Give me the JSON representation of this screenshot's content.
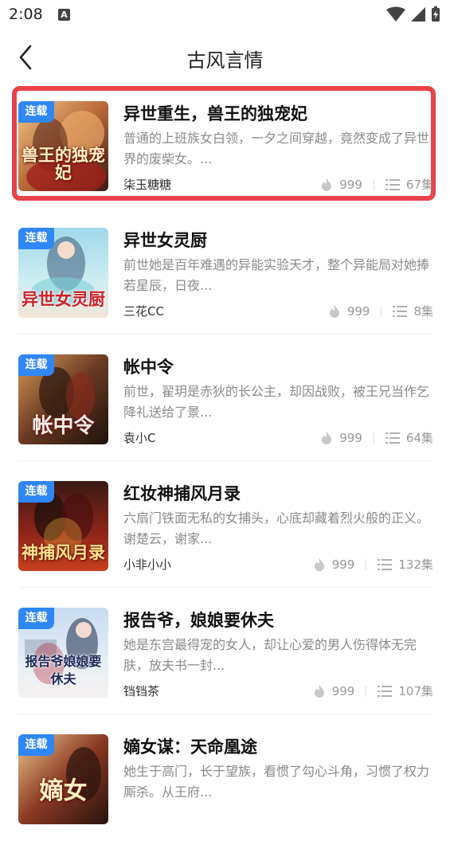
{
  "status": {
    "time": "2:08",
    "a_icon_letter": "A"
  },
  "header": {
    "title": "古风言情"
  },
  "books": [
    {
      "badge": "连载",
      "title": "异世重生，兽王的独宠妃",
      "description": "普通的上班族女白领，一夕之间穿越，竟然变成了异世界的废柴女。...",
      "author": "柒玉糖糖",
      "likes": "999",
      "episodes": "67集",
      "cover_text": "兽王的独宠妃",
      "highlighted": true
    },
    {
      "badge": "连载",
      "title": "异世女灵厨",
      "description": "前世她是百年难遇的异能实验天才，整个异能局对她捧若星辰，日夜...",
      "author": "三花CC",
      "likes": "999",
      "episodes": "8集",
      "cover_text": "异世女灵厨",
      "highlighted": false
    },
    {
      "badge": "连载",
      "title": "帐中令",
      "description": "前世，翟玥是赤狄的长公主，却因战败，被王兄当作乞降礼送给了景...",
      "author": "袁小C",
      "likes": "999",
      "episodes": "64集",
      "cover_text": "帐中令",
      "highlighted": false
    },
    {
      "badge": "连载",
      "title": "红妆神捕风月录",
      "description": "六扇门铁面无私的女捕头，心底却藏着烈火般的正义。谢楚云，谢家...",
      "author": "小非小小",
      "likes": "999",
      "episodes": "132集",
      "cover_text": "神捕风月录",
      "highlighted": false
    },
    {
      "badge": "连载",
      "title": "报告爷，娘娘要休夫",
      "description": "她是东宫最得宠的女人，却让心爱的男人伤得体无完肤，放夫书一封...",
      "author": "铛铛茶",
      "likes": "999",
      "episodes": "107集",
      "cover_text": "报告爷娘娘要休夫",
      "highlighted": false
    },
    {
      "badge": "连载",
      "title": "嫡女谋：天命凰途",
      "description": "她生于高门，长于望族，看惯了勾心斗角，习惯了权力厮杀。从王府...",
      "author": "",
      "likes": "",
      "episodes": "",
      "cover_text": "嫡女",
      "highlighted": false
    }
  ],
  "colors": {
    "badge_blue": "#2f86f5",
    "highlight_red": "#e8424a"
  }
}
